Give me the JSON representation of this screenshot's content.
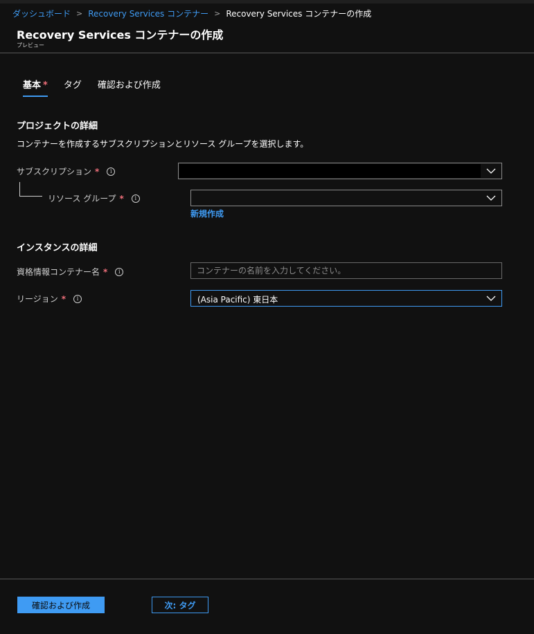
{
  "breadcrumb": {
    "items": [
      "ダッシュボード",
      "Recovery Services コンテナー"
    ],
    "current": "Recovery Services コンテナーの作成",
    "separator": ">"
  },
  "header": {
    "title": "Recovery Services コンテナーの作成",
    "subtitle": "プレビュー"
  },
  "tabs": [
    {
      "label": "基本",
      "required": "*",
      "active": true
    },
    {
      "label": "タグ"
    },
    {
      "label": "確認および作成"
    }
  ],
  "project": {
    "title": "プロジェクトの詳細",
    "description": "コンテナーを作成するサブスクリプションとリソース グループを選択します。",
    "subscription_label": "サブスクリプション",
    "resource_group_label": "リソース グループ",
    "create_new_link": "新規作成"
  },
  "instance": {
    "title": "インスタンスの詳細",
    "vault_name_label": "資格情報コンテナー名",
    "vault_name_placeholder": "コンテナーの名前を入力してください。",
    "region_label": "リージョン",
    "region_value": "(Asia Pacific) 東日本"
  },
  "common": {
    "required_mark": "*",
    "info_glyph": "i"
  },
  "footer": {
    "review_create_button": "確認および作成",
    "next_button": "次: タグ"
  },
  "colors": {
    "background": "#111111",
    "accent": "#3f9bf3",
    "required": "#f1707b",
    "focus_border": "#3f9bf3"
  },
  "icons": {
    "dropdown": "chevron-down-icon",
    "info": "info-icon",
    "breadcrumb_separator": "chevron-right-icon"
  }
}
